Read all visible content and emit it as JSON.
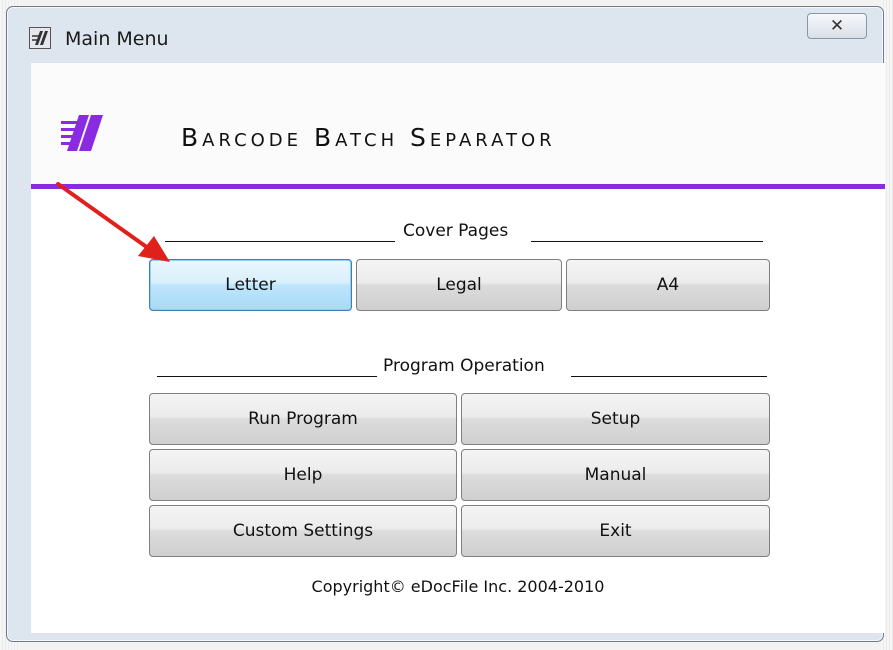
{
  "window": {
    "title": "Main Menu",
    "close_label": "✕"
  },
  "header": {
    "app_title": "Barcode Batch Separator"
  },
  "cover_pages": {
    "label": "Cover Pages",
    "buttons": [
      "Letter",
      "Legal",
      "A4"
    ]
  },
  "program_operation": {
    "label": "Program Operation",
    "buttons": [
      "Run Program",
      "Setup",
      "Help",
      "Manual",
      "Custom Settings",
      "Exit"
    ]
  },
  "footer": {
    "copyright": "Copyright© eDocFile Inc. 2004-2010"
  },
  "colors": {
    "accent_purple": "#8a2be2",
    "annotation_arrow": "#e0201a"
  },
  "annotation": {
    "points_to": "Letter"
  }
}
